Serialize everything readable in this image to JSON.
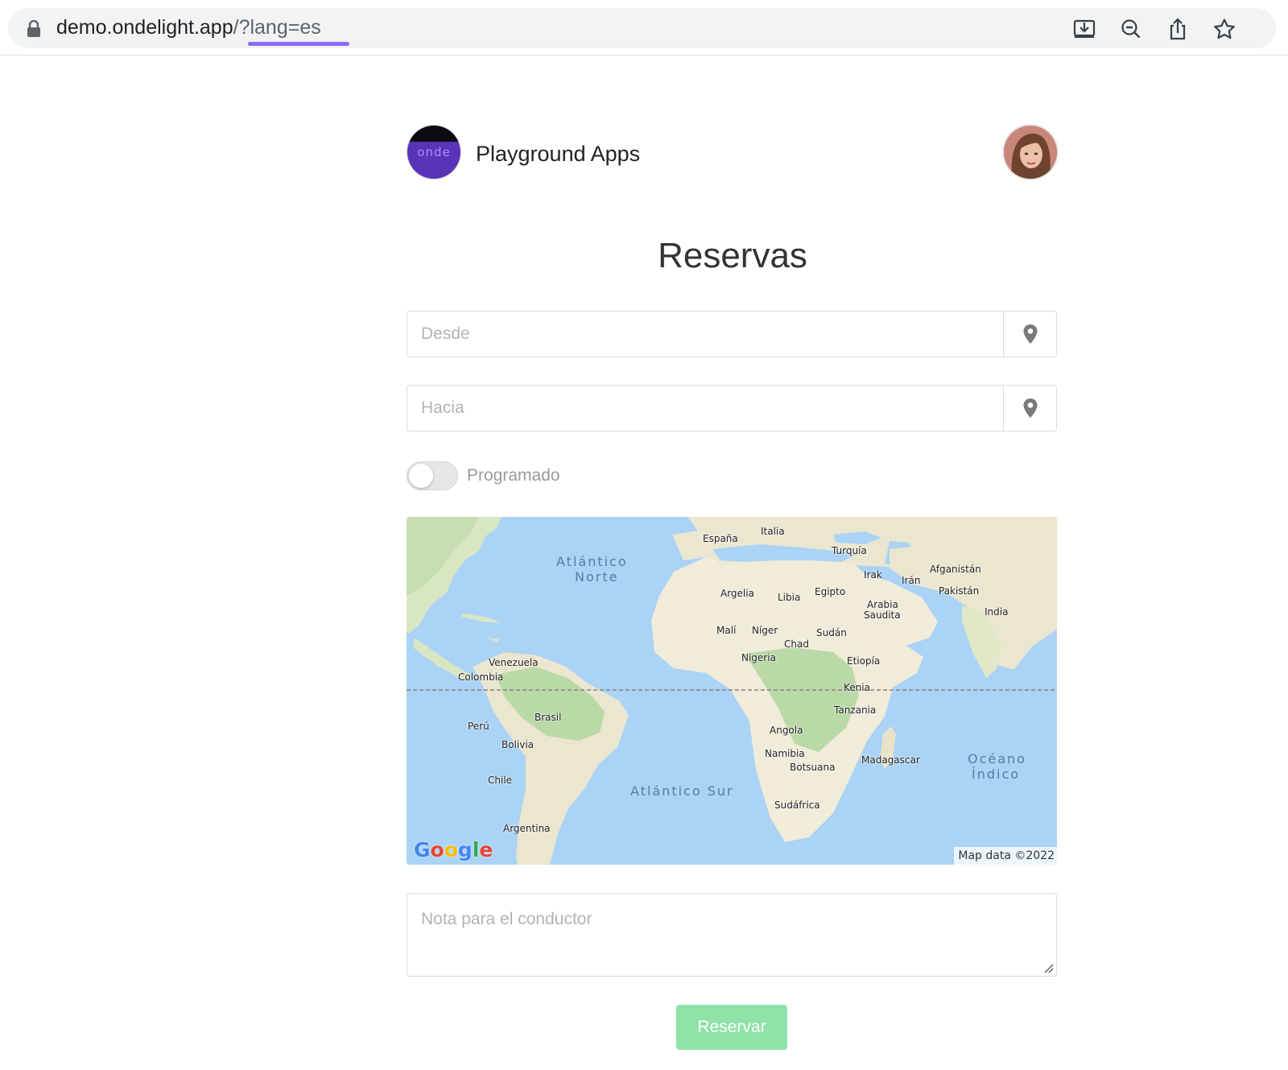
{
  "browser": {
    "url_host": "demo.ondelight.app",
    "url_query": "/?lang=es",
    "icons": [
      "lock-icon",
      "install-app-icon",
      "zoom-out-icon",
      "share-icon",
      "bookmark-star-icon"
    ]
  },
  "header": {
    "logo_text": "onde",
    "app_name": "Playground Apps"
  },
  "page_title": "Reservas",
  "form": {
    "from_placeholder": "Desde",
    "to_placeholder": "Hacia",
    "scheduled_label": "Programado",
    "scheduled_on": false,
    "note_placeholder": "Nota para el conductor",
    "submit_label": "Reservar"
  },
  "map": {
    "oceans": {
      "north_atlantic_1": "Atlántico",
      "north_atlantic_2": "Norte",
      "south_atlantic": "Atlántico Sur",
      "indian_1": "Océano",
      "indian_2": "Índico"
    },
    "labels": {
      "espana": "España",
      "italia": "Italia",
      "turquia": "Turquía",
      "afganistan": "Afganistán",
      "irak": "Irak",
      "iran": "Irán",
      "pakistan": "Pakistán",
      "argelia": "Argelia",
      "libia": "Libia",
      "egipto": "Egipto",
      "arabia_1": "Arabia",
      "arabia_2": "Saudita",
      "india": "India",
      "mali": "Malí",
      "niger": "Níger",
      "sudan": "Sudán",
      "chad": "Chad",
      "nigeria": "Nigeria",
      "etiopia": "Etiopía",
      "venezuela": "Venezuela",
      "colombia": "Colombia",
      "kenia": "Kenia",
      "tanzania": "Tanzania",
      "brasil": "Brasil",
      "peru": "Perú",
      "angola": "Angola",
      "bolivia": "Bolivia",
      "namibia": "Namibia",
      "madagascar": "Madagascar",
      "botsuana": "Botsuana",
      "chile": "Chile",
      "sudafrica": "Sudáfrica",
      "argentina": "Argentina"
    },
    "provider": "Google",
    "attribution": "Map data ©2022"
  },
  "colors": {
    "accent_underline": "#8a6df2",
    "logo_purple": "#5a33b8",
    "submit_green": "#8fe3a9",
    "map_water": "#aad3f5",
    "map_land": "#f0ecd9",
    "map_forest": "#b9d9a6"
  }
}
